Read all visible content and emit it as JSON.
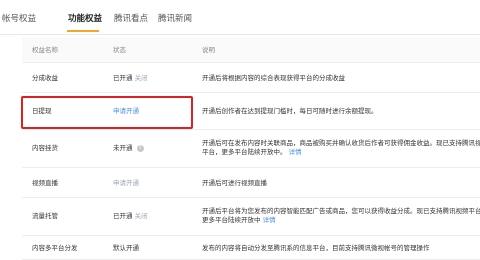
{
  "tabs": [
    "帐号权益",
    "功能权益",
    "腾讯看点",
    "腾讯新闻"
  ],
  "table": {
    "headers": [
      "权益名称",
      "状态",
      "说明"
    ],
    "rows": [
      {
        "name": "分成收益",
        "status": "已开通",
        "status_link": "关闭",
        "desc": "开通后将根据内容的综合表现获得平台的分成收益"
      },
      {
        "name": "日提现",
        "status_link": "申请开通",
        "desc": "开通后创作者在达到提现门槛时，每日可随时进行余额提现。"
      },
      {
        "name": "内容挂货",
        "status": "未开通",
        "desc": "开通后可在发布内容时关联商品，商品被购买并确认收货后作者可获得佣金收益。现已支持腾讯视频平台，更多平台陆续开放中。",
        "desc_link": "详情"
      },
      {
        "name": "视频直播",
        "status_link": "申请开通",
        "desc": "开通后可进行视频直播"
      },
      {
        "name": "流量托管",
        "status": "已开通",
        "status_link": "关闭",
        "desc": "开通后平台将为您发布的内容智能匹配广告或商品，您可以获得收益分成。现已支持腾讯视频平台，更多平台陆续开放中",
        "desc_link": "详情"
      },
      {
        "name": "内容多平台分发",
        "status": "默认开通",
        "desc": "发布的内容将自动分发至腾讯系的信息平台，目前支持腾讯微视帐号的管理操作"
      }
    ]
  },
  "icons": {
    "help": "help-circle-icon"
  },
  "colors": {
    "accent": "#f5a623",
    "link": "#4a90e2",
    "highlight": "#e02020"
  }
}
